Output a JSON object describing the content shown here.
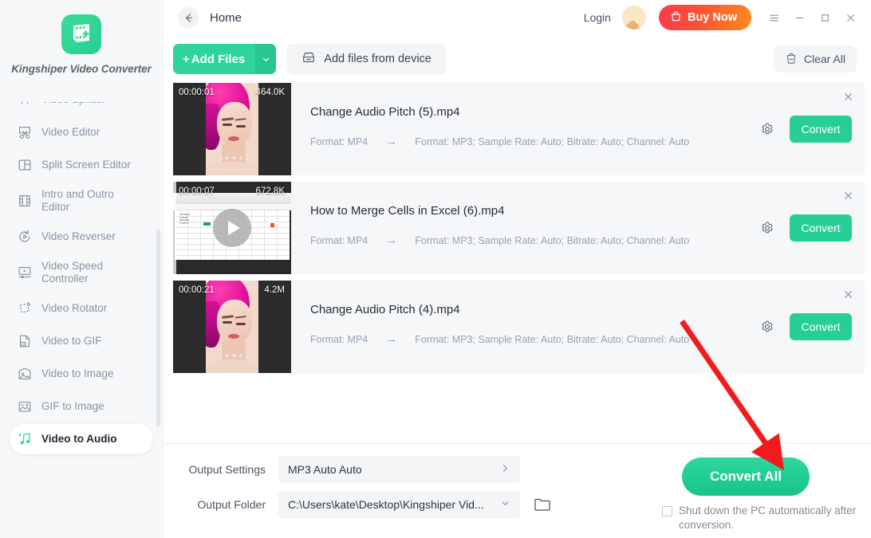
{
  "app": {
    "name": "Kingshiper Video Converter",
    "logo_icon": "app-logo-icon"
  },
  "sidebar": {
    "items": [
      {
        "label": "Video Splitter",
        "icon": "video-splitter-icon",
        "active": false,
        "clipped": true
      },
      {
        "label": "Video Editor",
        "icon": "video-editor-icon",
        "active": false
      },
      {
        "label": "Split Screen Editor",
        "icon": "split-screen-editor-icon",
        "active": false
      },
      {
        "label": "Intro and Outro Editor",
        "icon": "intro-outro-editor-icon",
        "active": false
      },
      {
        "label": "Video Reverser",
        "icon": "video-reverser-icon",
        "active": false
      },
      {
        "label": "Video Speed Controller",
        "icon": "video-speed-controller-icon",
        "active": false
      },
      {
        "label": "Video Rotator",
        "icon": "video-rotator-icon",
        "active": false
      },
      {
        "label": "Video to GIF",
        "icon": "video-to-gif-icon",
        "active": false
      },
      {
        "label": "Video to Image",
        "icon": "video-to-image-icon",
        "active": false
      },
      {
        "label": "GIF to Image",
        "icon": "gif-to-image-icon",
        "active": false
      },
      {
        "label": "Video to Audio",
        "icon": "video-to-audio-icon",
        "active": true
      }
    ]
  },
  "titlebar": {
    "back_icon": "back-arrow-icon",
    "title": "Home",
    "login_label": "Login",
    "avatar_icon": "user-avatar-icon",
    "buy_label": "Buy Now",
    "buy_icon": "shopping-bag-icon",
    "menu_icon": "hamburger-menu-icon",
    "minimize_icon": "minimize-icon",
    "maximize_icon": "maximize-icon",
    "close_icon": "close-icon"
  },
  "toolbar": {
    "add_files_label": "Add Files",
    "add_files_plus": "+",
    "add_files_caret_icon": "chevron-down-icon",
    "add_device_label": "Add files from device",
    "add_device_icon": "device-icon",
    "clear_all_label": "Clear All",
    "clear_all_icon": "trash-icon"
  },
  "files": [
    {
      "name": "Change Audio Pitch (5).mp4",
      "duration": "00:00:01",
      "size": "464.0K",
      "source_format": "Format: MP4",
      "arrow": "→",
      "target_format": "Format: MP3;  Sample Rate: Auto;  Bitrate: Auto;  Channel: Auto",
      "convert_label": "Convert",
      "gear_icon": "settings-gear-icon",
      "close_icon": "remove-file-icon",
      "thumb_type": "woman",
      "has_play": false
    },
    {
      "name": "How to Merge Cells in Excel (6).mp4",
      "duration": "00:00:07",
      "size": "672.8K",
      "source_format": "Format: MP4",
      "arrow": "→",
      "target_format": "Format: MP3;  Sample Rate: Auto;  Bitrate: Auto;  Channel: Auto",
      "convert_label": "Convert",
      "gear_icon": "settings-gear-icon",
      "close_icon": "remove-file-icon",
      "thumb_type": "excel",
      "has_play": true,
      "play_icon": "play-icon"
    },
    {
      "name": "Change Audio Pitch (4).mp4",
      "duration": "00:00:21",
      "size": "4.2M",
      "source_format": "Format: MP4",
      "arrow": "→",
      "target_format": "Format: MP3;  Sample Rate: Auto;  Bitrate: Auto;  Channel: Auto",
      "convert_label": "Convert",
      "gear_icon": "settings-gear-icon",
      "close_icon": "remove-file-icon",
      "thumb_type": "woman",
      "has_play": false
    }
  ],
  "bottom": {
    "output_settings_label": "Output Settings",
    "output_settings_value": "MP3  Auto  Auto",
    "output_settings_caret_icon": "chevron-right-icon",
    "output_folder_label": "Output Folder",
    "output_folder_value": "C:\\Users\\kate\\Desktop\\Kingshiper Vid...",
    "output_folder_caret_icon": "chevron-down-icon",
    "browse_icon": "folder-icon",
    "convert_all_label": "Convert All",
    "shutdown_label": "Shut down the PC automatically after conversion.",
    "shutdown_checked": false
  },
  "annotation": {
    "arrow_color": "#f21b1b",
    "arrow_from": "855,403",
    "arrow_to": "968,568"
  },
  "colors": {
    "accent_green": "#27cf97",
    "buy_gradient_start": "#fa3c4c",
    "buy_gradient_end": "#fd8a1e",
    "sidebar_bg": "#f7f8fa",
    "row_bg": "#f6f7f9",
    "annotation_red": "#f21b1b"
  }
}
